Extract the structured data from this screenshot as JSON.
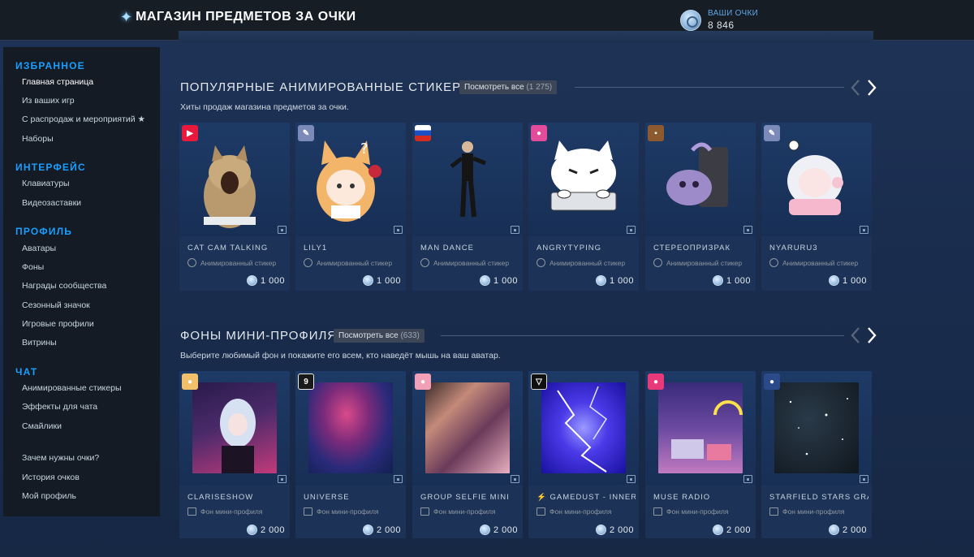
{
  "header": {
    "title": "МАГАЗИН ПРЕДМЕТОВ ЗА ОЧКИ",
    "points_label": "ВАШИ ОЧКИ",
    "points_value": "8 846"
  },
  "sidebar": {
    "favorites": {
      "title": "ИЗБРАННОЕ",
      "items": [
        "Главная страница",
        "Из ваших игр",
        "С распродаж и мероприятий ★",
        "Наборы"
      ]
    },
    "interface": {
      "title": "ИНТЕРФЕЙС",
      "items": [
        "Клавиатуры",
        "Видеозаставки"
      ]
    },
    "profile": {
      "title": "ПРОФИЛЬ",
      "items": [
        "Аватары",
        "Фоны",
        "Награды сообщества",
        "Сезонный значок",
        "Игровые профили",
        "Витрины"
      ]
    },
    "chat": {
      "title": "ЧАТ",
      "items": [
        "Анимированные стикеры",
        "Эффекты для чата",
        "Смайлики"
      ]
    },
    "extra": [
      "Зачем нужны очки?",
      "История очков",
      "Мой профиль"
    ]
  },
  "stickers_section": {
    "title": "ПОПУЛЯРНЫЕ АНИМИРОВАННЫЕ СТИКЕРЫ",
    "view_all": "Посмотреть все",
    "count": "(1 275)",
    "subtitle": "Хиты продаж магазина предметов за очки.",
    "items": [
      {
        "name": "CAT CAM TALKING",
        "type": "Анимированный стикер",
        "price": "1 000"
      },
      {
        "name": "LILY1",
        "type": "Анимированный стикер",
        "price": "1 000"
      },
      {
        "name": "MAN DANCE",
        "type": "Анимированный стикер",
        "price": "1 000"
      },
      {
        "name": "ANGRYTYPING",
        "type": "Анимированный стикер",
        "price": "1 000"
      },
      {
        "name": "СТЕРЕОПРИЗРАК",
        "type": "Анимированный стикер",
        "price": "1 000"
      },
      {
        "name": "NYARURU3",
        "type": "Анимированный стикер",
        "price": "1 000"
      }
    ]
  },
  "backgrounds_section": {
    "title": "ФОНЫ МИНИ-ПРОФИЛЯ",
    "view_all": "Посмотреть все",
    "count": "(633)",
    "subtitle": "Выберите любимый фон и покажите его всем, кто наведёт мышь на ваш аватар.",
    "items": [
      {
        "name": "CLARISESHOW",
        "type": "Фон мини-профиля",
        "price": "2 000"
      },
      {
        "name": "UNIVERSE",
        "type": "Фон мини-профиля",
        "price": "2 000"
      },
      {
        "name": "GROUP SELFIE MINI",
        "type": "Фон мини-профиля",
        "price": "2 000"
      },
      {
        "name": "GAMEDUST - INNER PL",
        "type": "Фон мини-профиля",
        "price": "2 000"
      },
      {
        "name": "MUSE RADIO",
        "type": "Фон мини-профиля",
        "price": "2 000"
      },
      {
        "name": "STARFIELD STARS GRAV W",
        "type": "Фон мини-профиля",
        "price": "2 000"
      }
    ]
  },
  "colors": {
    "accent": "#1a9fff",
    "page_bg": "#1a2d4f",
    "sidebar_bg": "#141b24",
    "header_bg": "#171d25"
  }
}
